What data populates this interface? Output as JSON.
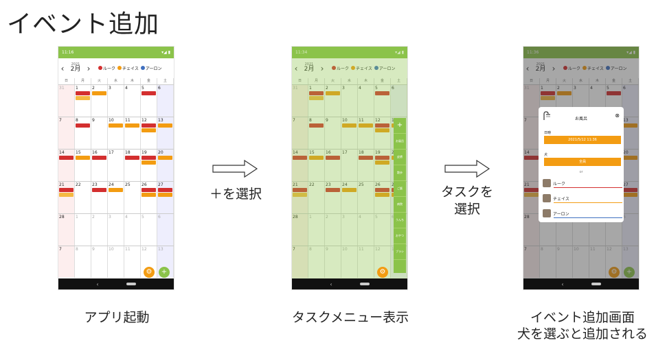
{
  "page": {
    "title": "イベント追加"
  },
  "common": {
    "status_time_1": "11:16",
    "status_time_2": "11:34",
    "status_time_3": "11:36",
    "status_icons": "▾◢ ▮",
    "year": "2021",
    "month": "2月",
    "prev": "‹",
    "next": "›",
    "legend": [
      {
        "label": "ルーク",
        "color": "#d32f2f"
      },
      {
        "label": "チェイス",
        "color": "#f39c12"
      },
      {
        "label": "アーロン",
        "color": "#3f6fbf"
      }
    ],
    "weekdays": [
      "日",
      "月",
      "火",
      "水",
      "木",
      "金",
      "土"
    ],
    "weeks": [
      [
        "31",
        "1",
        "2",
        "3",
        "4",
        "5",
        "6"
      ],
      [
        "7",
        "8",
        "9",
        "10",
        "11",
        "12",
        "13"
      ],
      [
        "14",
        "15",
        "16",
        "17",
        "18",
        "19",
        "20"
      ],
      [
        "21",
        "22",
        "23",
        "24",
        "25",
        "26",
        "27"
      ],
      [
        "28",
        "1",
        "2",
        "3",
        "4",
        "5",
        "6"
      ],
      [
        "7",
        "8",
        "9",
        "10",
        "11",
        "12",
        "13"
      ]
    ],
    "nav_back": "‹",
    "fab_gear": "⚙",
    "fab_plus": "+"
  },
  "steps": {
    "arrow1_label": "＋を選択",
    "arrow2_label": "タスクを\n選択"
  },
  "captions": {
    "c1": "アプリ起動",
    "c2": "タスクメニュー表示",
    "c3_line1": "イベント追加画面",
    "c3_line2": "犬を選ぶと追加される"
  },
  "task_menu": {
    "items": [
      "+",
      "お風呂",
      "皮膚",
      "散歩",
      "ご飯",
      "病院",
      "うんち",
      "おやつ",
      "ブラシ"
    ]
  },
  "dialog": {
    "title": "お風呂",
    "close": "⊗",
    "datetime_label": "日時",
    "datetime_value": "2021/5/12 11:36",
    "dog_label": "犬",
    "all_button": "全員",
    "or": "or",
    "dogs": [
      {
        "name": "ルーク",
        "color": "#d32f2f"
      },
      {
        "name": "チェイス",
        "color": "#f39c12"
      },
      {
        "name": "アーロン",
        "color": "#3f6fbf"
      }
    ]
  }
}
